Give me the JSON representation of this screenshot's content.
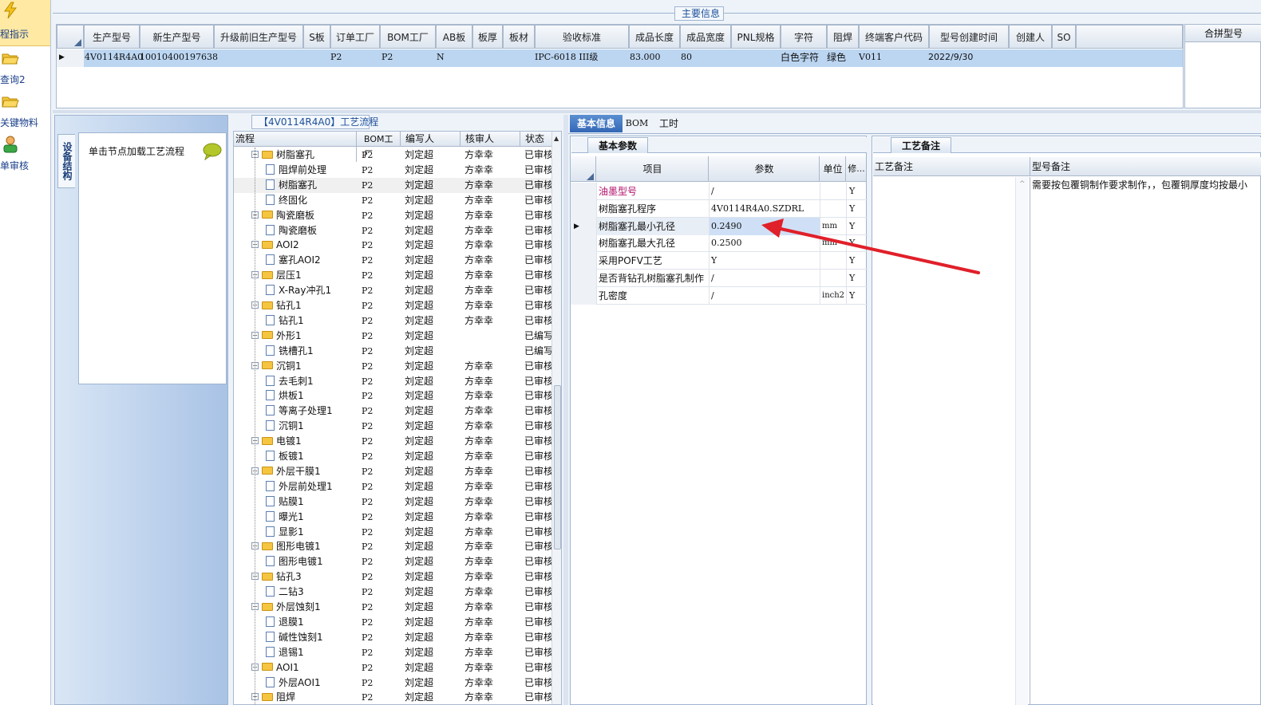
{
  "sidebar": {
    "items": [
      {
        "label": "程指示",
        "icon": "lightning-icon"
      },
      {
        "label": "查询2",
        "icon": "folder-open-icon"
      },
      {
        "label": "关键物料",
        "icon": "folder-open-icon"
      },
      {
        "label": "单审核",
        "icon": "user-icon"
      }
    ]
  },
  "main_info": {
    "title": "主要信息",
    "headers": [
      "生产型号",
      "新生产型号",
      "升级前旧生产型号",
      "S板",
      "订单工厂",
      "BOM工厂",
      "AB板",
      "板厚",
      "板材",
      "验收标准",
      "成品长度",
      "成品宽度",
      "PNL规格",
      "字符",
      "阻焊",
      "终端客户代码",
      "型号创建时间",
      "创建人",
      "SO"
    ],
    "row": {
      "生产型号": "4V0114R4A0",
      "新生产型号": "10010400197638",
      "订单工厂": "P2",
      "BOM工厂": "P2",
      "AB板": "N",
      "验收标准": "IPC-6018 III级",
      "成品长度": "83.000",
      "成品宽度": "80",
      "字符": "白色字符",
      "阻焊": "绿色",
      "终端客户代码": "V011",
      "型号创建时间": "2022/9/30"
    },
    "merge_header": "合拼型号"
  },
  "left_panel": {
    "vertical_tab": "设备结构",
    "node_hint": "单击节点加载工艺流程"
  },
  "process_flow": {
    "title": "【4V0114R4A0】工艺流程",
    "headers": {
      "flow": "流程",
      "bom": "BOM工厂",
      "writer": "编写人",
      "checker": "核审人",
      "status": "状态"
    },
    "rows": [
      {
        "name": "树脂塞孔",
        "type": "folder",
        "level": 0,
        "bom": "P2",
        "writer": "刘定超",
        "checker": "方幸幸",
        "status": "已审核"
      },
      {
        "name": "阻焊前处理",
        "type": "doc",
        "level": 1,
        "bom": "P2",
        "writer": "刘定超",
        "checker": "方幸幸",
        "status": "已审核"
      },
      {
        "name": "树脂塞孔",
        "type": "doc",
        "level": 1,
        "bom": "P2",
        "writer": "刘定超",
        "checker": "方幸幸",
        "status": "已审核",
        "selected": true
      },
      {
        "name": "终固化",
        "type": "doc",
        "level": 1,
        "bom": "P2",
        "writer": "刘定超",
        "checker": "方幸幸",
        "status": "已审核"
      },
      {
        "name": "陶瓷磨板",
        "type": "folder",
        "level": 0,
        "bom": "P2",
        "writer": "刘定超",
        "checker": "方幸幸",
        "status": "已审核"
      },
      {
        "name": "陶瓷磨板",
        "type": "doc",
        "level": 1,
        "bom": "P2",
        "writer": "刘定超",
        "checker": "方幸幸",
        "status": "已审核"
      },
      {
        "name": "AOI2",
        "type": "folder",
        "level": 0,
        "bom": "P2",
        "writer": "刘定超",
        "checker": "方幸幸",
        "status": "已审核"
      },
      {
        "name": "塞孔AOI2",
        "type": "doc",
        "level": 1,
        "bom": "P2",
        "writer": "刘定超",
        "checker": "方幸幸",
        "status": "已审核"
      },
      {
        "name": "层压1",
        "type": "folder",
        "level": 0,
        "bom": "P2",
        "writer": "刘定超",
        "checker": "方幸幸",
        "status": "已审核"
      },
      {
        "name": "X-Ray冲孔1",
        "type": "doc",
        "level": 1,
        "bom": "P2",
        "writer": "刘定超",
        "checker": "方幸幸",
        "status": "已审核"
      },
      {
        "name": "钻孔1",
        "type": "folder",
        "level": 0,
        "bom": "P2",
        "writer": "刘定超",
        "checker": "方幸幸",
        "status": "已审核"
      },
      {
        "name": "钻孔1",
        "type": "doc",
        "level": 1,
        "bom": "P2",
        "writer": "刘定超",
        "checker": "方幸幸",
        "status": "已审核"
      },
      {
        "name": "外形1",
        "type": "folder",
        "level": 0,
        "bom": "P2",
        "writer": "刘定超",
        "checker": "",
        "status": "已编写"
      },
      {
        "name": "铣槽孔1",
        "type": "doc",
        "level": 1,
        "bom": "P2",
        "writer": "刘定超",
        "checker": "",
        "status": "已编写"
      },
      {
        "name": "沉铜1",
        "type": "folder",
        "level": 0,
        "bom": "P2",
        "writer": "刘定超",
        "checker": "方幸幸",
        "status": "已审核"
      },
      {
        "name": "去毛刺1",
        "type": "doc",
        "level": 1,
        "bom": "P2",
        "writer": "刘定超",
        "checker": "方幸幸",
        "status": "已审核"
      },
      {
        "name": "烘板1",
        "type": "doc",
        "level": 1,
        "bom": "P2",
        "writer": "刘定超",
        "checker": "方幸幸",
        "status": "已审核"
      },
      {
        "name": "等离子处理1",
        "type": "doc",
        "level": 1,
        "bom": "P2",
        "writer": "刘定超",
        "checker": "方幸幸",
        "status": "已审核"
      },
      {
        "name": "沉铜1",
        "type": "doc",
        "level": 1,
        "bom": "P2",
        "writer": "刘定超",
        "checker": "方幸幸",
        "status": "已审核"
      },
      {
        "name": "电镀1",
        "type": "folder",
        "level": 0,
        "bom": "P2",
        "writer": "刘定超",
        "checker": "方幸幸",
        "status": "已审核"
      },
      {
        "name": "板镀1",
        "type": "doc",
        "level": 1,
        "bom": "P2",
        "writer": "刘定超",
        "checker": "方幸幸",
        "status": "已审核"
      },
      {
        "name": "外层干膜1",
        "type": "folder",
        "level": 0,
        "bom": "P2",
        "writer": "刘定超",
        "checker": "方幸幸",
        "status": "已审核"
      },
      {
        "name": "外层前处理1",
        "type": "doc",
        "level": 1,
        "bom": "P2",
        "writer": "刘定超",
        "checker": "方幸幸",
        "status": "已审核"
      },
      {
        "name": "贴膜1",
        "type": "doc",
        "level": 1,
        "bom": "P2",
        "writer": "刘定超",
        "checker": "方幸幸",
        "status": "已审核"
      },
      {
        "name": "曝光1",
        "type": "doc",
        "level": 1,
        "bom": "P2",
        "writer": "刘定超",
        "checker": "方幸幸",
        "status": "已审核"
      },
      {
        "name": "显影1",
        "type": "doc",
        "level": 1,
        "bom": "P2",
        "writer": "刘定超",
        "checker": "方幸幸",
        "status": "已审核"
      },
      {
        "name": "图形电镀1",
        "type": "folder",
        "level": 0,
        "bom": "P2",
        "writer": "刘定超",
        "checker": "方幸幸",
        "status": "已审核"
      },
      {
        "name": "图形电镀1",
        "type": "doc",
        "level": 1,
        "bom": "P2",
        "writer": "刘定超",
        "checker": "方幸幸",
        "status": "已审核"
      },
      {
        "name": "钻孔3",
        "type": "folder",
        "level": 0,
        "bom": "P2",
        "writer": "刘定超",
        "checker": "方幸幸",
        "status": "已审核"
      },
      {
        "name": "二钻3",
        "type": "doc",
        "level": 1,
        "bom": "P2",
        "writer": "刘定超",
        "checker": "方幸幸",
        "status": "已审核"
      },
      {
        "name": "外层蚀刻1",
        "type": "folder",
        "level": 0,
        "bom": "P2",
        "writer": "刘定超",
        "checker": "方幸幸",
        "status": "已审核"
      },
      {
        "name": "退膜1",
        "type": "doc",
        "level": 1,
        "bom": "P2",
        "writer": "刘定超",
        "checker": "方幸幸",
        "status": "已审核"
      },
      {
        "name": "碱性蚀刻1",
        "type": "doc",
        "level": 1,
        "bom": "P2",
        "writer": "刘定超",
        "checker": "方幸幸",
        "status": "已审核"
      },
      {
        "name": "退锡1",
        "type": "doc",
        "level": 1,
        "bom": "P2",
        "writer": "刘定超",
        "checker": "方幸幸",
        "status": "已审核"
      },
      {
        "name": "AOI1",
        "type": "folder",
        "level": 0,
        "bom": "P2",
        "writer": "刘定超",
        "checker": "方幸幸",
        "status": "已审核"
      },
      {
        "name": "外层AOI1",
        "type": "doc",
        "level": 1,
        "bom": "P2",
        "writer": "刘定超",
        "checker": "方幸幸",
        "status": "已审核"
      },
      {
        "name": "阻焊",
        "type": "folder",
        "level": 0,
        "bom": "P2",
        "writer": "刘定超",
        "checker": "方幸幸",
        "status": "已审核"
      }
    ]
  },
  "detail_tabs": [
    "基本信息",
    "BOM",
    "工时"
  ],
  "basic_params": {
    "subtab": "基本参数",
    "headers": {
      "item": "项目",
      "param": "参数",
      "unit": "单位",
      "mod": "修..."
    },
    "rows": [
      {
        "item": "油墨型号",
        "param": "/",
        "unit": "",
        "mod": "Y",
        "highlight": true
      },
      {
        "item": "树脂塞孔程序",
        "param": "4V0114R4A0.SZDRL",
        "unit": "",
        "mod": "Y"
      },
      {
        "item": "树脂塞孔最小孔径",
        "param": "0.2490",
        "unit": "mm",
        "mod": "Y",
        "selected": true
      },
      {
        "item": "树脂塞孔最大孔径",
        "param": "0.2500",
        "unit": "mm",
        "mod": "Y"
      },
      {
        "item": "采用POFV工艺",
        "param": "Y",
        "unit": "",
        "mod": "Y"
      },
      {
        "item": "是否背钻孔树脂塞孔制作",
        "param": "/",
        "unit": "",
        "mod": "Y"
      },
      {
        "item": "孔密度",
        "param": "/",
        "unit": "inch2",
        "mod": "Y"
      }
    ]
  },
  "process_notes": {
    "tab": "工艺备注",
    "col1": "工艺备注",
    "col2": "型号备注",
    "model_note": "需要按包覆铜制作要求制作，，包覆铜厚度均按最小"
  },
  "colors": {
    "arrow": "#e0202a",
    "accent": "#3467b5",
    "selected_row": "#bcd6f2"
  }
}
